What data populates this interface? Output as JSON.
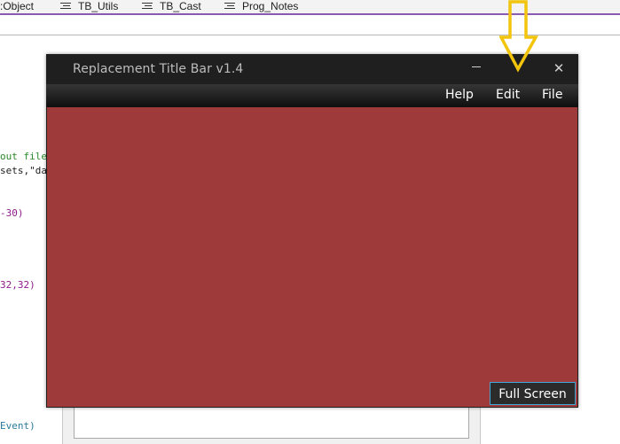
{
  "ide": {
    "tabs": [
      {
        "label": ":Object"
      },
      {
        "label": "TB_Utils"
      },
      {
        "label": "TB_Cast"
      },
      {
        "label": "Prog_Notes"
      }
    ],
    "code_fragments": [
      {
        "text": "out file",
        "color": "#2a8a2a"
      },
      {
        "text": "sets,\"da",
        "color": "#1e1e1e"
      },
      {
        "text": "-30)",
        "color": "#8b1a8b"
      },
      {
        "text": "32,32)",
        "color": "#8b1a8b"
      },
      {
        "text": "Event)",
        "color": "#2b7a9b"
      }
    ]
  },
  "window": {
    "title": "Replacement Title Bar v1.4",
    "close_glyph": "✕",
    "menu": [
      {
        "label": "Help"
      },
      {
        "label": "Edit"
      },
      {
        "label": "File"
      }
    ],
    "content_color": "#9e3a3a",
    "full_screen_label": "Full Screen"
  },
  "annotation": {
    "arrow_color": "#f2c40c",
    "icon": "down-arrow-icon"
  }
}
